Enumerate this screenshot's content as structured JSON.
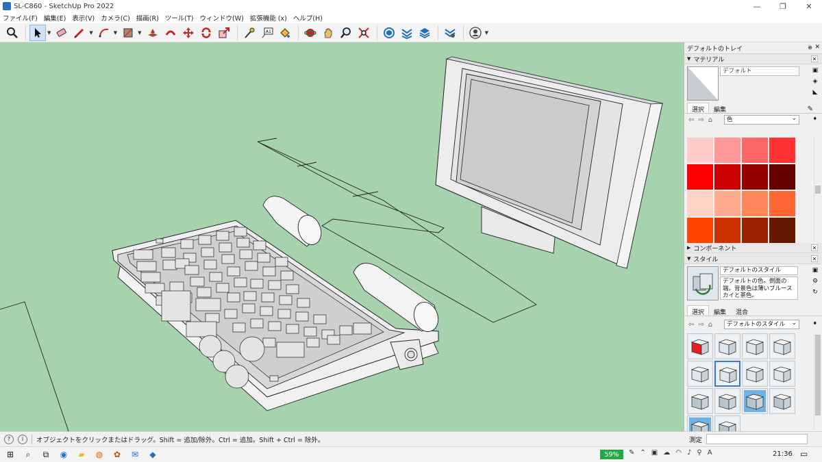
{
  "window": {
    "title": "SL-C860 - SketchUp Pro 2022",
    "min": "—",
    "max": "❐",
    "close": "✕"
  },
  "menu": [
    "ファイル(F)",
    "編集(E)",
    "表示(V)",
    "カメラ(C)",
    "描画(R)",
    "ツール(T)",
    "ウィンドウ(W)",
    "拡張機能 (x)",
    "ヘルプ(H)"
  ],
  "colors": {
    "viewport_bg": "#a6d2ad",
    "selection": "#3a78c3",
    "battery": "#22a845"
  },
  "tray": {
    "title": "デフォルトのトレイ",
    "materials": {
      "header": "マテリアル",
      "name": "デフォルト",
      "tabs": [
        "選択",
        "編集"
      ],
      "library": "色",
      "swatches": [
        "#ffcccc",
        "#ff9999",
        "#ff6666",
        "#ff3333",
        "#ff0000",
        "#cc0000",
        "#990000",
        "#660000",
        "#ffd3c4",
        "#ffab90",
        "#ff875a",
        "#ff6633",
        "#ff4400",
        "#cc3300",
        "#992200",
        "#661a00"
      ]
    },
    "components": {
      "header": "コンポーネント"
    },
    "styles": {
      "header": "スタイル",
      "name": "デフォルトのスタイル",
      "description": "デフォルトの色。側面の端。背景色は薄いブルースカイと茶色。",
      "tabs": [
        "選択",
        "編集",
        "混合"
      ],
      "library": "デフォルトのスタイル"
    }
  },
  "status": {
    "message": "オブジェクトをクリックまたはドラッグ。Shift = 追加/除外。Ctrl = 追加。Shift + Ctrl = 除外。",
    "measure_label": "測定"
  },
  "taskbar": {
    "battery": "59%",
    "time": "21:36"
  }
}
